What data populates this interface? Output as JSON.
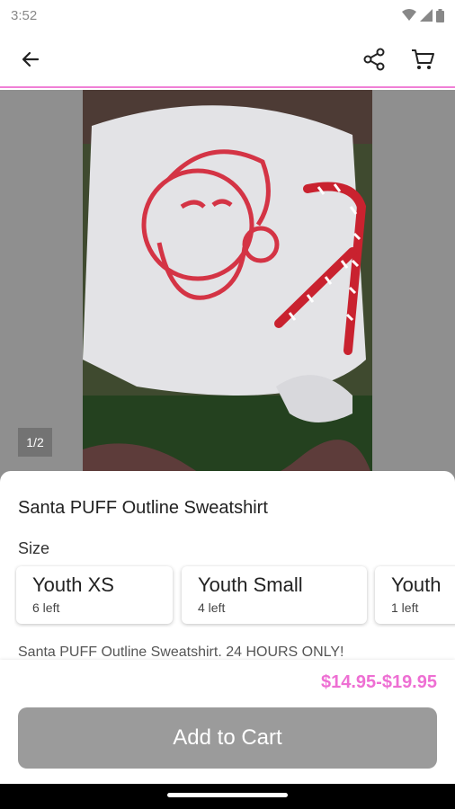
{
  "status_bar": {
    "time": "3:52",
    "icons": [
      "wifi-icon",
      "signal-icon",
      "battery-icon"
    ]
  },
  "app_bar": {
    "icons": [
      "back-arrow-icon",
      "share-icon",
      "cart-icon"
    ]
  },
  "gallery": {
    "page_indicator": "1/2"
  },
  "product": {
    "title": "Santa PUFF Outline Sweatshirt",
    "size_label": "Size",
    "sizes": [
      {
        "name": "Youth XS",
        "stock": "6 left"
      },
      {
        "name": "Youth Small",
        "stock": "4 left"
      },
      {
        "name": "Youth",
        "stock": "1 left"
      }
    ],
    "description": "Santa PUFF Outline Sweatshirt. 24 HOURS ONLY!",
    "price": "$14.95-$19.95"
  },
  "actions": {
    "add_to_cart_label": "Add to Cart"
  },
  "colors": {
    "accent": "#ee6fd3",
    "button_disabled": "#9b9b9b",
    "divider": "#f07fd6"
  }
}
